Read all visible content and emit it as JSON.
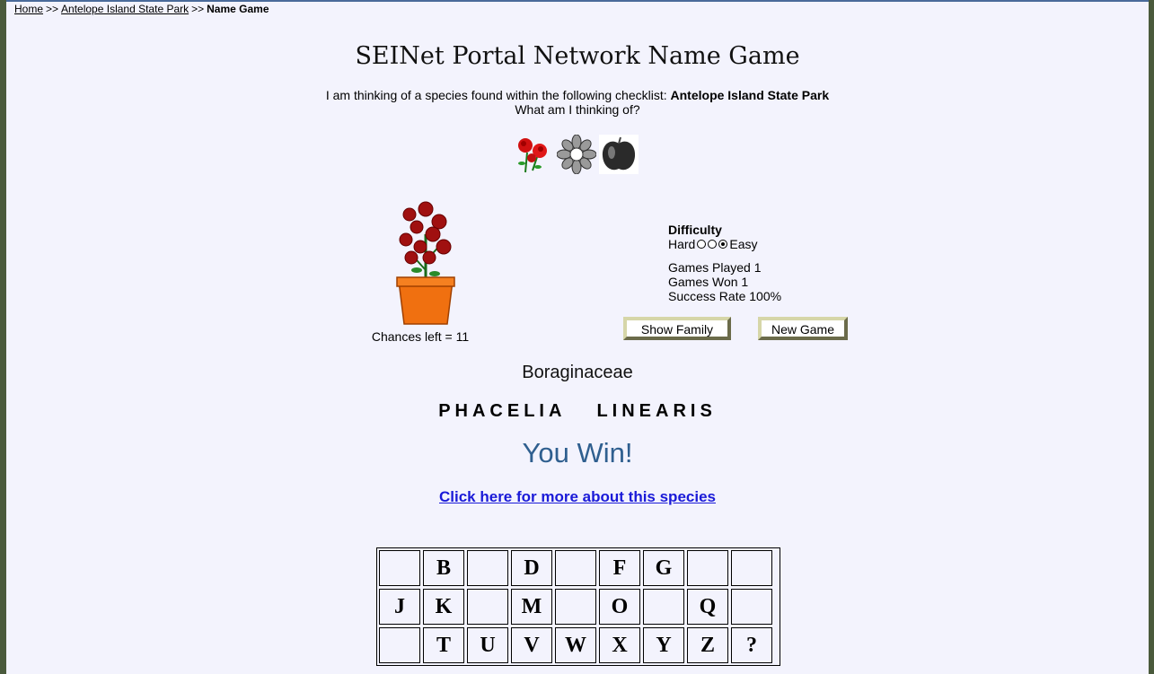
{
  "breadcrumb": {
    "home": "Home",
    "sep1": ">>",
    "park": "Antelope Island State Park",
    "sep2": ">>",
    "current": "Name Game"
  },
  "title": "SEINet Portal Network Name Game",
  "intro": {
    "line1_prefix": "I am thinking of a species found within the following checklist:",
    "checklist": "Antelope Island State Park",
    "line2": "What am I thinking of?"
  },
  "icons": [
    "rose-icon",
    "flower-icon",
    "apple-icon"
  ],
  "chances": "Chances left = 11",
  "stats": {
    "difficulty_label": "Difficulty",
    "hard": "Hard",
    "easy": "Easy",
    "selected_level": 3,
    "games_played": "Games Played 1",
    "games_won": "Games Won 1",
    "success_rate": "Success Rate 100%"
  },
  "buttons": {
    "show_family": "Show Family",
    "new_game": "New Game"
  },
  "family": "Boraginaceae",
  "species": {
    "genus": "PHACELIA",
    "epithet": "LINEARIS"
  },
  "result": "You Win!",
  "more_link": "Click here for more about this species",
  "letters": [
    "",
    "B",
    "",
    "D",
    "",
    "F",
    "G",
    "",
    "",
    "J",
    "K",
    "",
    "M",
    "",
    "O",
    "",
    "Q",
    "",
    "",
    "T",
    "U",
    "V",
    "W",
    "X",
    "Y",
    "Z",
    "?"
  ],
  "colors": {
    "win": "#2f5f8f",
    "link": "#1a1ad8",
    "background": "#f3f3fd"
  }
}
